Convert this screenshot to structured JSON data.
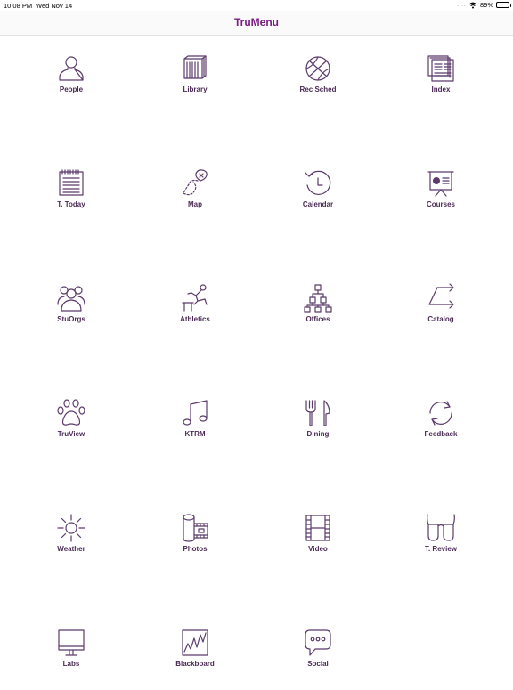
{
  "status": {
    "time": "10:08 PM",
    "date": "Wed Nov 14",
    "signal": "....",
    "battery": "89%"
  },
  "header": {
    "title": "TruMenu"
  },
  "menu": [
    {
      "label": "People",
      "icon": "person-icon"
    },
    {
      "label": "Library",
      "icon": "books-icon"
    },
    {
      "label": "Rec Sched",
      "icon": "basketball-icon"
    },
    {
      "label": "Index",
      "icon": "index-pages-icon"
    },
    {
      "label": "T. Today",
      "icon": "newspaper-icon"
    },
    {
      "label": "Map",
      "icon": "map-route-icon"
    },
    {
      "label": "Calendar",
      "icon": "history-clock-icon"
    },
    {
      "label": "Courses",
      "icon": "presentation-board-icon"
    },
    {
      "label": "StuOrgs",
      "icon": "group-people-icon"
    },
    {
      "label": "Athletics",
      "icon": "athlete-hurdle-icon"
    },
    {
      "label": "Offices",
      "icon": "org-chart-icon"
    },
    {
      "label": "Catalog",
      "icon": "catalog-arrows-icon"
    },
    {
      "label": "TruView",
      "icon": "paw-print-icon"
    },
    {
      "label": "KTRM",
      "icon": "music-note-icon"
    },
    {
      "label": "Dining",
      "icon": "fork-knife-icon"
    },
    {
      "label": "Feedback",
      "icon": "refresh-arrows-icon"
    },
    {
      "label": "Weather",
      "icon": "sun-icon"
    },
    {
      "label": "Photos",
      "icon": "film-roll-icon"
    },
    {
      "label": "Video",
      "icon": "film-strip-icon"
    },
    {
      "label": "T. Review",
      "icon": "glasses-icon"
    },
    {
      "label": "Labs",
      "icon": "monitor-icon"
    },
    {
      "label": "Blackboard",
      "icon": "chart-board-icon"
    },
    {
      "label": "Social",
      "icon": "chat-bubble-icon"
    }
  ]
}
